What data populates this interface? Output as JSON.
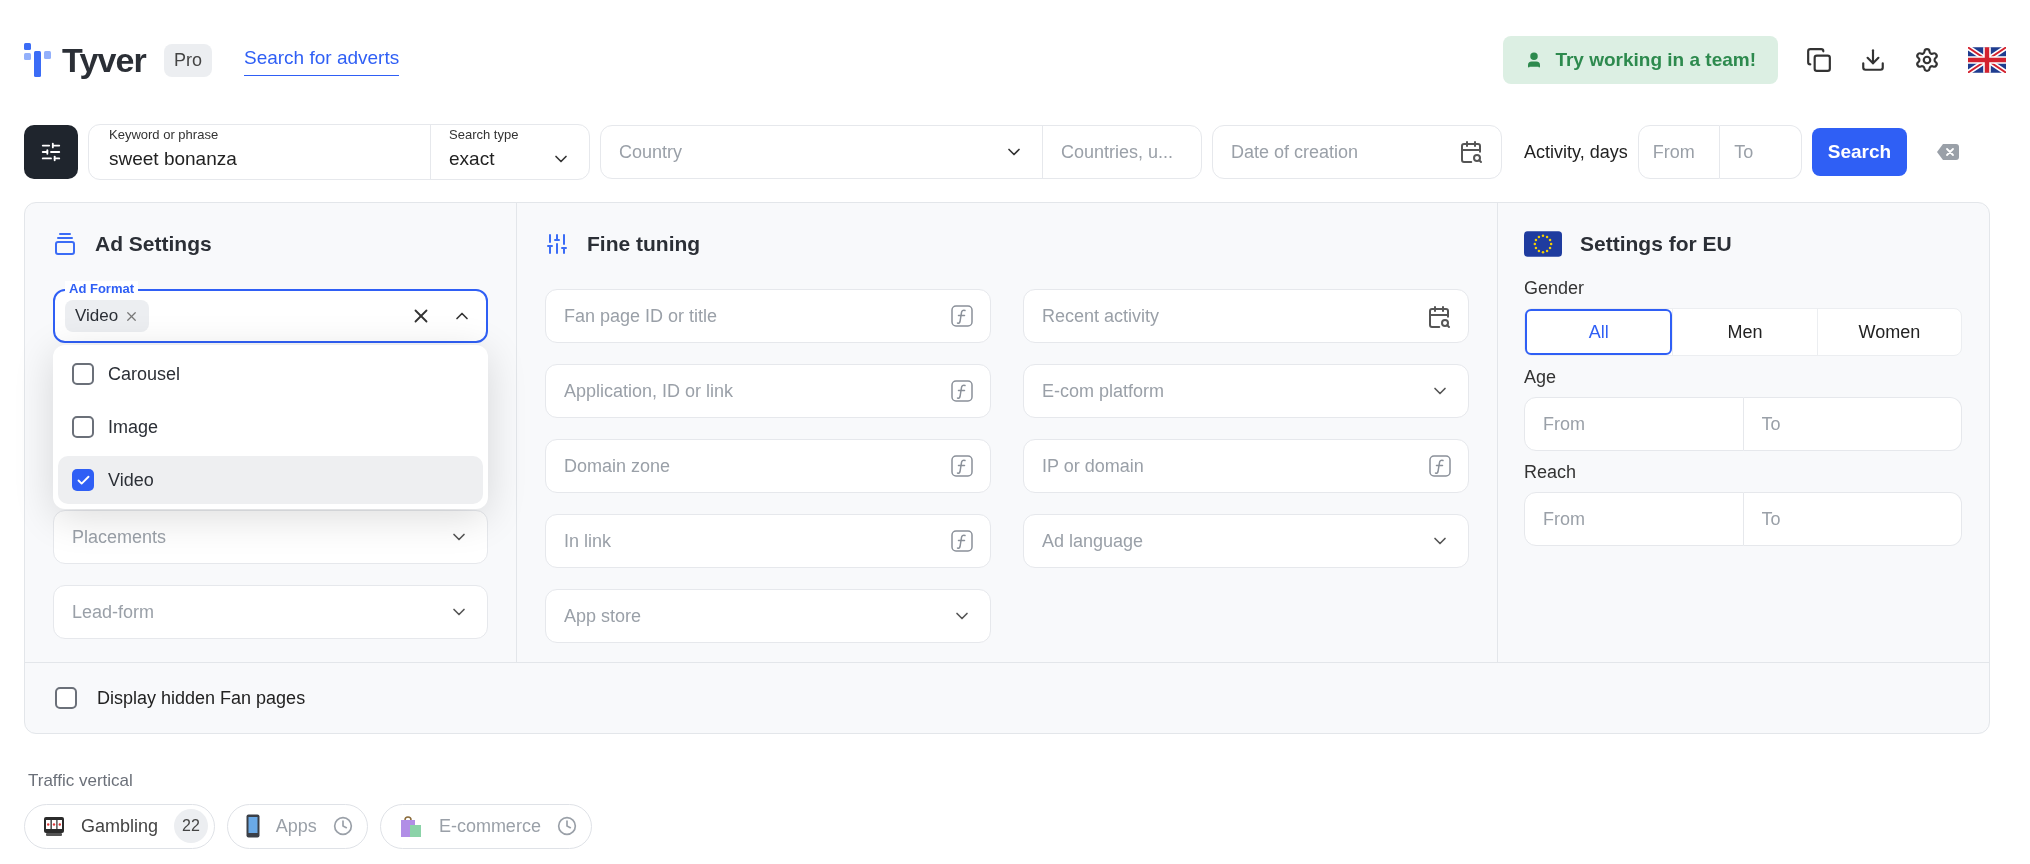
{
  "header": {
    "logo": "Tyver",
    "plan_badge": "Pro",
    "nav": [
      {
        "label": "Search for adverts",
        "selected": true
      }
    ],
    "team_button": "Try working in a team!"
  },
  "search_bar": {
    "keyword": {
      "label": "Keyword or phrase",
      "value": "sweet bonanza"
    },
    "search_type": {
      "label": "Search type",
      "value": "exact"
    },
    "country": {
      "placeholder": "Country"
    },
    "countries": {
      "placeholder": "Countries, u..."
    },
    "date": {
      "placeholder": "Date of creation"
    },
    "activity": {
      "label": "Activity, days",
      "from": {
        "placeholder": "From"
      },
      "to": {
        "placeholder": "To"
      }
    },
    "search_button": "Search"
  },
  "ad_settings": {
    "title": "Ad Settings",
    "ad_format": {
      "label": "Ad Format",
      "chips": [
        "Video"
      ],
      "expanded": true,
      "options": [
        {
          "label": "Carousel",
          "checked": false,
          "selected": false
        },
        {
          "label": "Image",
          "checked": false,
          "selected": false
        },
        {
          "label": "Video",
          "checked": true,
          "selected": true
        }
      ]
    },
    "fields": [
      {
        "placeholder": "Placements"
      },
      {
        "placeholder": "Lead-form"
      }
    ]
  },
  "fine_tuning": {
    "title": "Fine tuning",
    "fields": [
      {
        "placeholder": "Fan page ID or title",
        "kind": "function"
      },
      {
        "placeholder": "Recent activity",
        "kind": "date"
      },
      {
        "placeholder": "Application, ID or link",
        "kind": "function"
      },
      {
        "placeholder": "E-com platform",
        "kind": "select"
      },
      {
        "placeholder": "Domain zone",
        "kind": "function"
      },
      {
        "placeholder": "IP or domain",
        "kind": "function"
      },
      {
        "placeholder": "In link",
        "kind": "function"
      },
      {
        "placeholder": "Ad language",
        "kind": "select"
      },
      {
        "placeholder": "App store",
        "kind": "select"
      }
    ]
  },
  "eu_settings": {
    "title": "Settings for EU",
    "gender": {
      "label": "Gender",
      "options": [
        {
          "label": "All",
          "selected": true
        },
        {
          "label": "Men",
          "selected": false
        },
        {
          "label": "Women",
          "selected": false
        }
      ]
    },
    "age": {
      "label": "Age",
      "from": {
        "placeholder": "From"
      },
      "to": {
        "placeholder": "To"
      }
    },
    "reach": {
      "label": "Reach",
      "from": {
        "placeholder": "From"
      },
      "to": {
        "placeholder": "To"
      }
    }
  },
  "hidden_fan_pages": {
    "label": "Display hidden Fan pages",
    "checked": false
  },
  "traffic_vertical": {
    "label": "Traffic vertical",
    "chips": [
      {
        "label": "Gambling",
        "kind": "count",
        "count": "22"
      },
      {
        "label": "Apps",
        "kind": "pending"
      },
      {
        "label": "E-commerce",
        "kind": "pending"
      }
    ]
  }
}
